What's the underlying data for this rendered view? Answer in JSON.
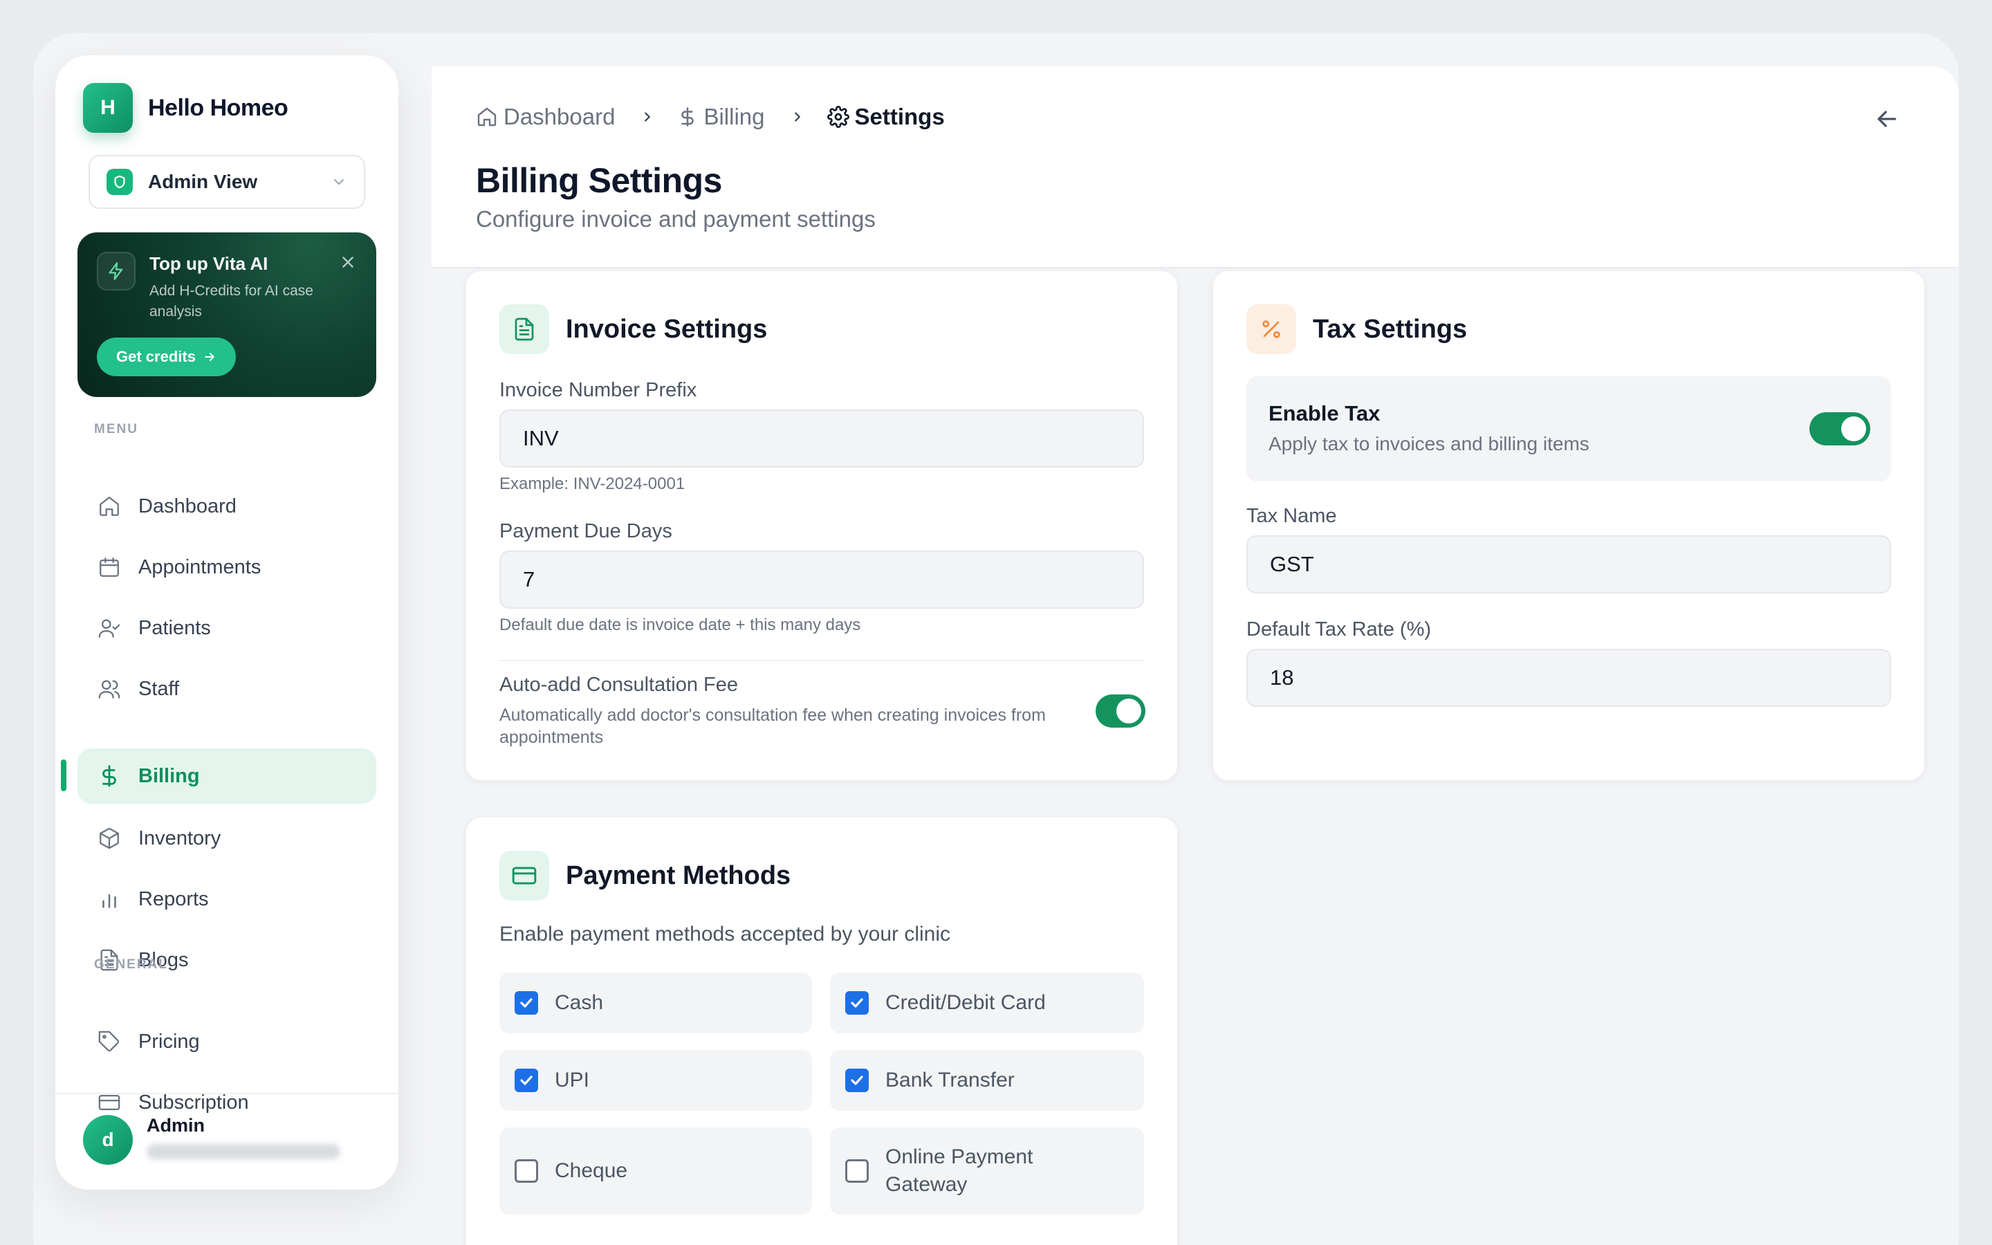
{
  "brand": {
    "logo_letter": "H",
    "name": "Hello Homeo"
  },
  "view_selector": {
    "label": "Admin View"
  },
  "promo": {
    "title": "Top up Vita AI",
    "description": "Add H-Credits for AI case analysis",
    "button_label": "Get credits"
  },
  "sidebar": {
    "menu_heading": "MENU",
    "general_heading": "GENERAL",
    "menu_items": [
      {
        "label": "Dashboard",
        "icon": "home-icon"
      },
      {
        "label": "Appointments",
        "icon": "calendar-icon"
      },
      {
        "label": "Patients",
        "icon": "user-check-icon"
      },
      {
        "label": "Staff",
        "icon": "users-icon"
      },
      {
        "label": "Billing",
        "icon": "dollar-icon",
        "active": true
      },
      {
        "label": "Inventory",
        "icon": "box-icon"
      },
      {
        "label": "Reports",
        "icon": "bar-chart-icon"
      },
      {
        "label": "Blogs",
        "icon": "file-text-icon"
      }
    ],
    "general_items": [
      {
        "label": "Pricing",
        "icon": "tag-icon"
      },
      {
        "label": "Subscription",
        "icon": "credit-card-icon"
      }
    ]
  },
  "user": {
    "avatar_letter": "d",
    "name": "Admin"
  },
  "breadcrumb": {
    "items": [
      "Dashboard",
      "Billing",
      "Settings"
    ]
  },
  "page": {
    "title": "Billing Settings",
    "subtitle": "Configure invoice and payment settings"
  },
  "invoice_settings": {
    "title": "Invoice Settings",
    "prefix_label": "Invoice Number Prefix",
    "prefix_value": "INV",
    "prefix_hint": "Example: INV-2024-0001",
    "due_days_label": "Payment Due Days",
    "due_days_value": "7",
    "due_days_hint": "Default due date is invoice date + this many days",
    "auto_fee_label": "Auto-add Consultation Fee",
    "auto_fee_desc": "Automatically add doctor's consultation fee when creating invoices from appointments",
    "auto_fee_enabled": true
  },
  "tax_settings": {
    "title": "Tax Settings",
    "enable_label": "Enable Tax",
    "enable_desc": "Apply tax to invoices and billing items",
    "enabled": true,
    "tax_name_label": "Tax Name",
    "tax_name_value": "GST",
    "rate_label": "Default Tax Rate (%)",
    "rate_value": "18"
  },
  "payment_methods": {
    "title": "Payment Methods",
    "description": "Enable payment methods accepted by your clinic",
    "options": [
      {
        "label": "Cash",
        "checked": true
      },
      {
        "label": "Credit/Debit Card",
        "checked": true
      },
      {
        "label": "UPI",
        "checked": true
      },
      {
        "label": "Bank Transfer",
        "checked": true
      },
      {
        "label": "Cheque",
        "checked": false
      },
      {
        "label": "Online Payment Gateway",
        "checked": false
      }
    ]
  },
  "colors": {
    "accent_green": "#15935f",
    "checkbox_blue": "#1d6fe6",
    "active_nav_bg": "#e3f5ec",
    "tax_icon_orange": "#f28b3c"
  }
}
